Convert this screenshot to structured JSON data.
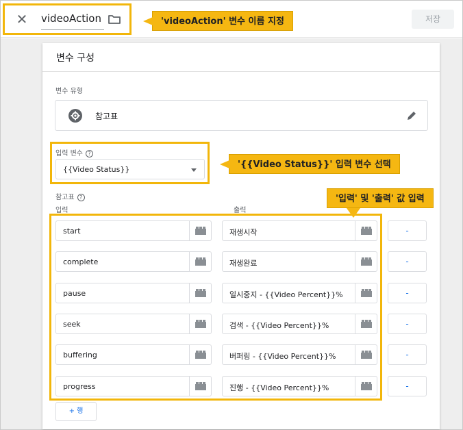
{
  "topbar": {
    "close_icon": "close-icon",
    "variable_name": "videoAction",
    "folder_icon": "folder-icon",
    "save_label": "저장"
  },
  "annotations": {
    "name": "'videoAction' 변수 이름 지정",
    "input_variable": "'{{Video Status}}' 입력 변수 선택",
    "input_output": "'입력' 및 '출력' 값 입력"
  },
  "colors": {
    "highlight": "#f2b60a",
    "callout_bg": "#f5b712",
    "link_blue": "#1a73e8"
  },
  "config": {
    "title": "변수 구성",
    "type_label": "변수 유형",
    "type_name": "참고표",
    "type_icon": "gear-icon",
    "edit_icon": "pencil-icon",
    "input_variable_label": "입력 변수",
    "input_variable_value": "{{Video Status}}",
    "table_label": "참고표",
    "col_input": "입력",
    "col_output": "출력",
    "rows": [
      {
        "input": "start",
        "output": "재생시작"
      },
      {
        "input": "complete",
        "output": "재생완료"
      },
      {
        "input": "pause",
        "output": "일시중지 - {{Video Percent}}%"
      },
      {
        "input": "seek",
        "output": "검색 - {{Video Percent}}%"
      },
      {
        "input": "buffering",
        "output": "버퍼링 - {{Video Percent}}%"
      },
      {
        "input": "progress",
        "output": "진행 - {{Video Percent}}%"
      }
    ],
    "remove_label": "-",
    "add_row_label": "+ 행"
  }
}
